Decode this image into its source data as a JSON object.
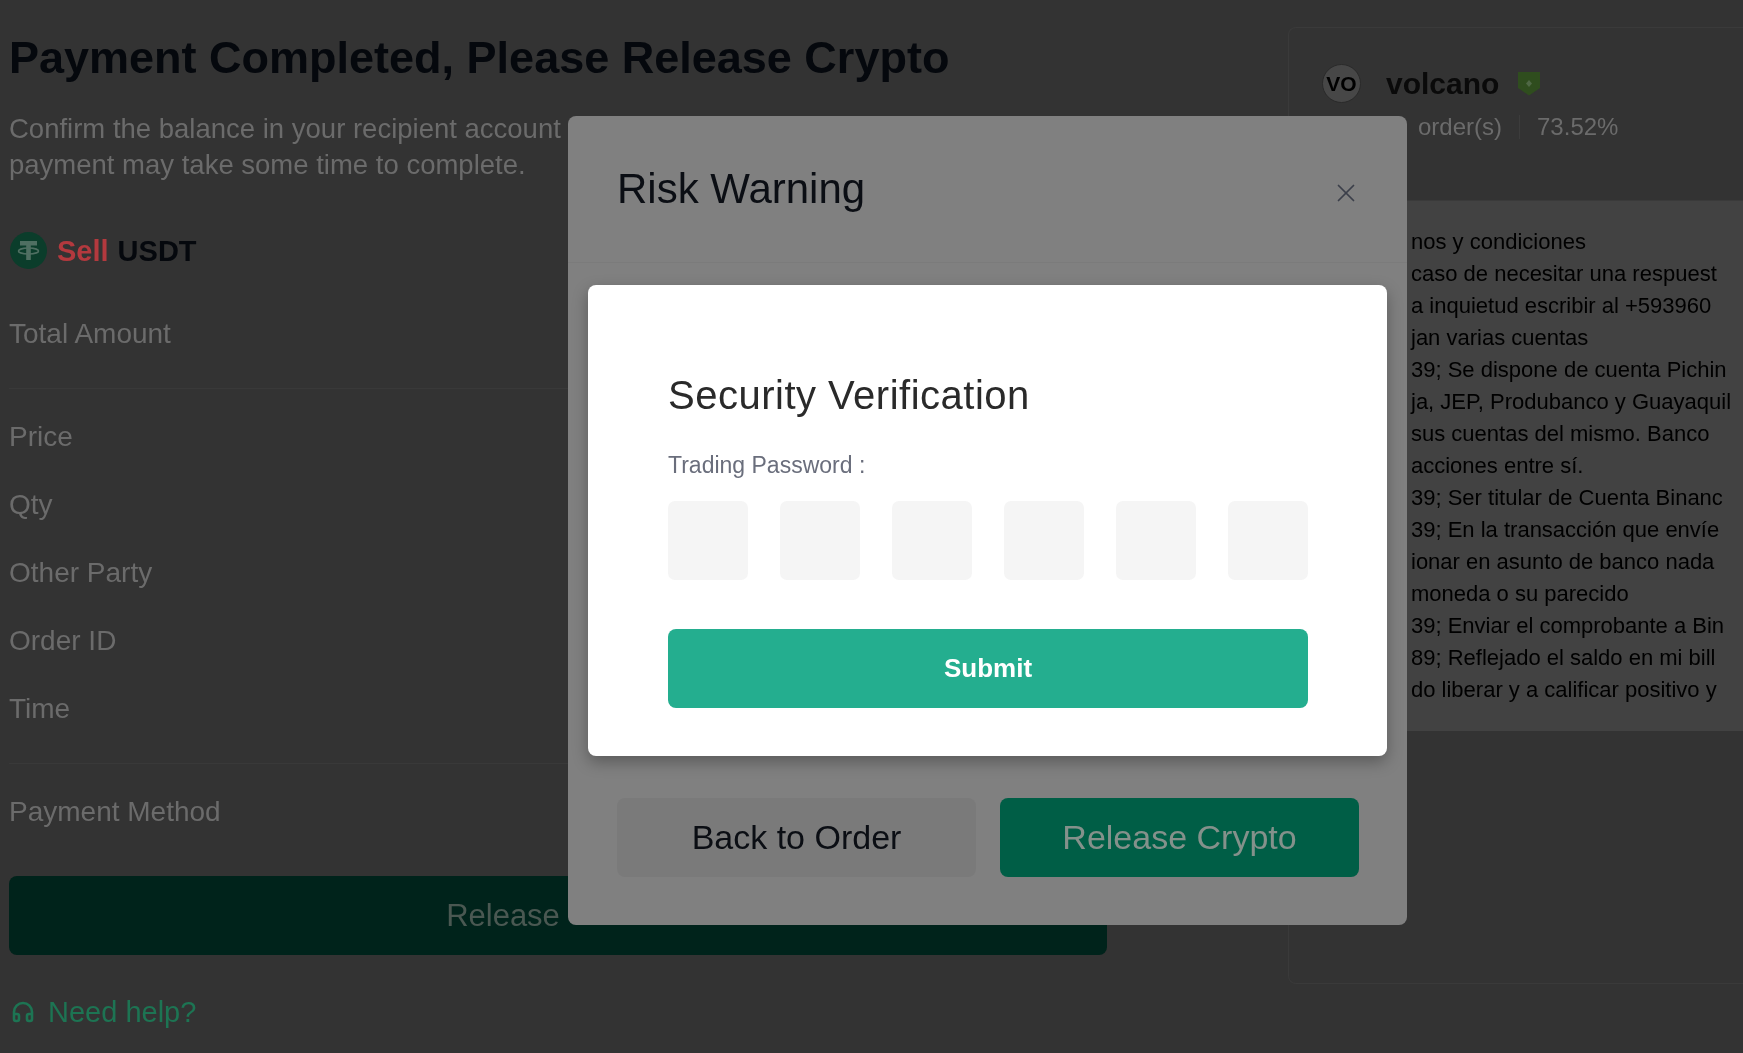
{
  "page": {
    "title": "Payment Completed, Please Release Crypto",
    "subtitle_lines": [
      "Confirm the balance in your recipient account",
      "payment may take some time to complete."
    ],
    "order": {
      "side": "Sell",
      "asset": "USDT"
    },
    "detail_groups": [
      {
        "labels": [
          "Total Amount"
        ]
      },
      {
        "labels": [
          "Price",
          "Qty",
          "Other Party",
          "Order ID",
          "Time"
        ]
      },
      {
        "labels": [
          "Payment Method"
        ]
      }
    ],
    "release_button": "Release",
    "help_link": "Need help?"
  },
  "counterparty": {
    "avatar": "VO",
    "name": "volcano",
    "verified": true,
    "orders": "order(s)",
    "completion_rate": "73.52%",
    "terms_lines": [
      "nos y condiciones",
      "caso de necesitar una respuest",
      "a inquietud escribir al +593960",
      "jan varias cuentas",
      "39; Se dispone de cuenta Pichin",
      "ja, JEP, Produbanco y Guayaquil",
      "sus cuentas del mismo. Banco",
      "acciones entre sí.",
      "39; Ser titular de Cuenta Binanc",
      "39; En la transacción que envíe",
      "ionar en asunto de banco nada",
      "moneda o su parecido",
      "39; Enviar el comprobante a Bin",
      "89; Reflejado el saldo en mi bill",
      "do liberar y a calificar positivo y"
    ]
  },
  "risk_warning_dialog": {
    "title": "Risk Warning",
    "buttons": [
      {
        "label": "Back to Order",
        "kind": "secondary"
      },
      {
        "label": "Release Crypto",
        "kind": "primary"
      }
    ]
  },
  "security_dialog": {
    "title": "Security Verification",
    "password_label": "Trading Password :",
    "digit_boxes": [
      {
        "filled": false
      },
      {
        "filled": false
      },
      {
        "filled": false
      },
      {
        "filled": false
      },
      {
        "filled": false
      },
      {
        "filled": false
      }
    ],
    "submit": "Submit"
  }
}
